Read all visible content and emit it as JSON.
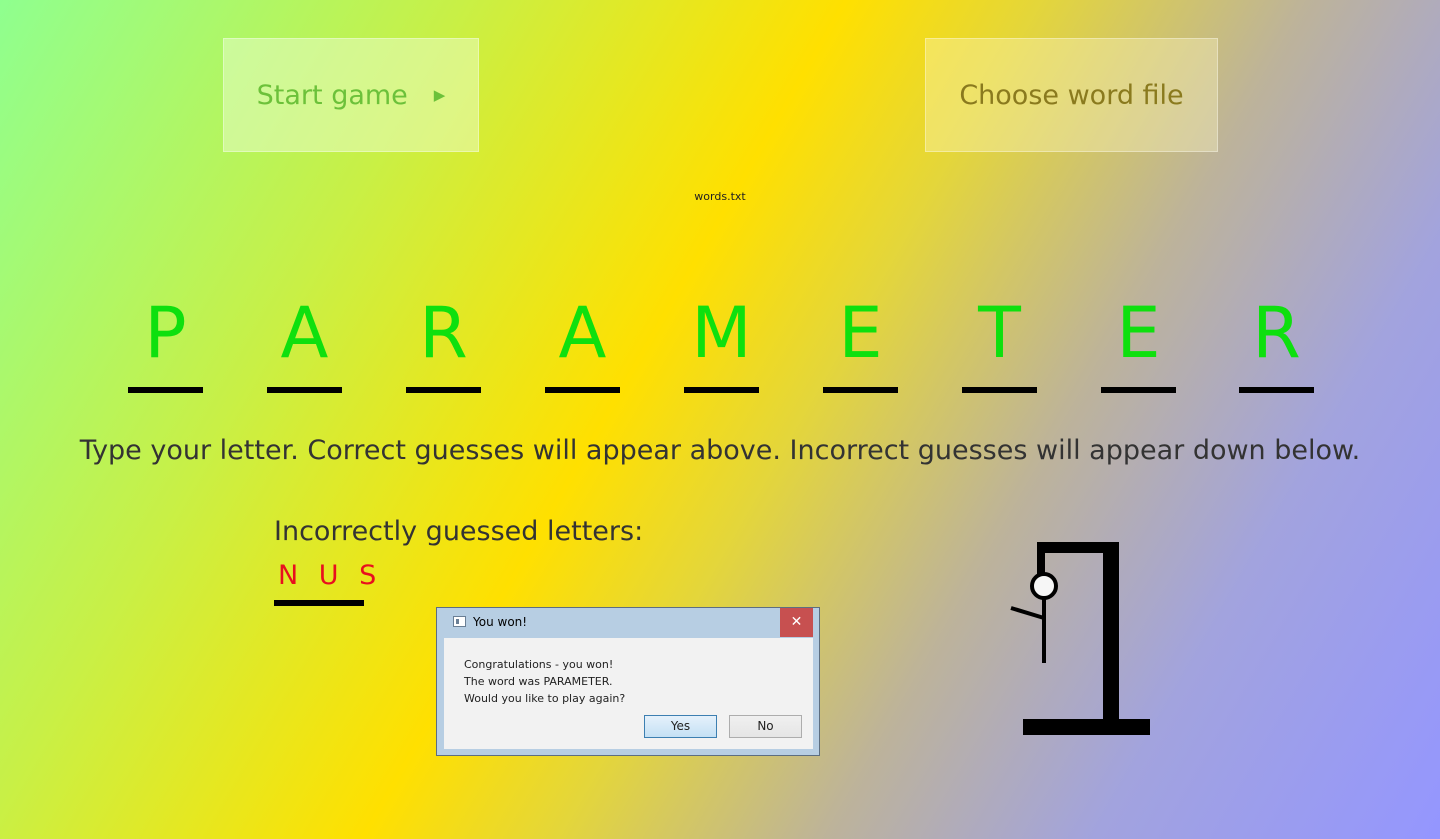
{
  "buttons": {
    "start_label": "Start game",
    "start_icon": "play-triangle",
    "choose_label": "Choose word file"
  },
  "file_name": "words.txt",
  "word_letters": [
    "P",
    "A",
    "R",
    "A",
    "M",
    "E",
    "T",
    "E",
    "R"
  ],
  "instructions": "Type your letter. Correct guesses will appear above. Incorrect guesses will appear down below.",
  "wrong": {
    "heading": "Incorrectly guessed letters:",
    "letters": "N U S"
  },
  "hangman": {
    "parts_shown": [
      "gallows-base",
      "gallows-post",
      "gallows-beam",
      "rope",
      "head",
      "body",
      "left-arm"
    ]
  },
  "dialog": {
    "title": "You won!",
    "close_glyph": "✕",
    "line1": "Congratulations - you won!",
    "line2": "The word was PARAMETER.",
    "line3": "Would you like to play again?",
    "yes_label": "Yes",
    "no_label": "No"
  },
  "colors": {
    "correct": "#0ee00e",
    "incorrect": "#e8101e"
  }
}
